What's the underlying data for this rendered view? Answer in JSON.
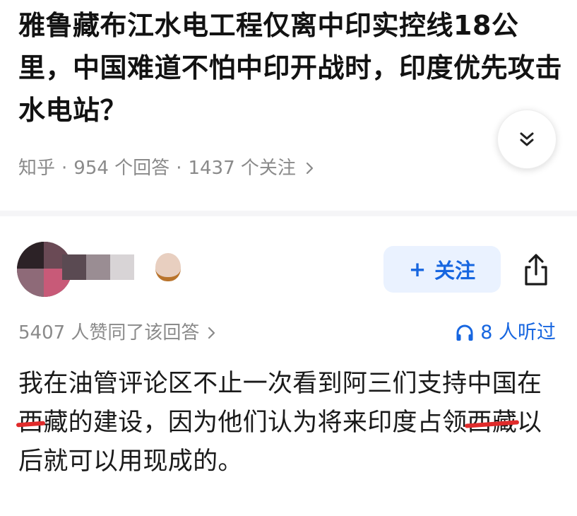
{
  "question": {
    "title": "雅鲁藏布江水电工程仅离中印实控线18公里，中国难道不怕中印开战时，印度优先攻击水电站？",
    "source": "知乎",
    "separator": "·",
    "answer_count": "954 个回答",
    "follower_count": "1437 个关注"
  },
  "answer_header": {
    "follow_label": "关注",
    "follow_plus": "+"
  },
  "vote_row": {
    "vote_text": "5407 人赞同了该回答",
    "listen_text": "8 人听过"
  },
  "answer": {
    "part1": "我在油管评论区不止一次看到阿三们支持中国在",
    "redacted1": "西",
    "part2": "藏的建设，因为他们认为将来印度占领",
    "redacted2": "西藏",
    "part3": "以后就可以用现成的。"
  },
  "colors": {
    "accent": "#1766e0",
    "follow_bg": "#eaf2ff",
    "meta_text": "#8a8a8a",
    "redaction": "#e02b2b"
  },
  "icons": {
    "expand": "double-chevron-down-icon",
    "meta_arrow": "chevron-right-icon",
    "share": "share-icon",
    "listen": "headphones-icon"
  }
}
